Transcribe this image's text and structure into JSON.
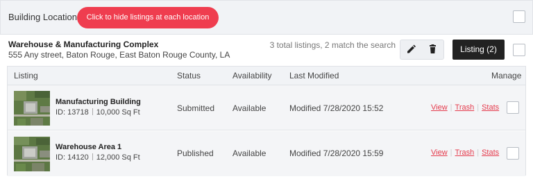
{
  "top_bar": {
    "title": "Building Locations",
    "hide_button": "Click to hide listings at each location"
  },
  "location": {
    "name": "Warehouse & Manufacturing Complex",
    "address": "555 Any street, Baton Rouge, East Baton Rouge County, LA",
    "count_text": "3 total listings, 2 match the search",
    "listing_button": "Listing (2)",
    "edit_icon": "pencil-icon",
    "delete_icon": "trash-icon"
  },
  "table": {
    "headers": {
      "listing": "Listing",
      "status": "Status",
      "availability": "Availability",
      "last_modified": "Last Modified",
      "manage": "Manage"
    },
    "rows": [
      {
        "title": "Manufacturing Building",
        "id_text": "ID: 13718",
        "size": "10,000 Sq Ft",
        "status": "Submitted",
        "availability": "Available",
        "modified": "Modified 7/28/2020 15:52",
        "actions": [
          "View",
          "Trash",
          "Stats"
        ]
      },
      {
        "title": "Warehouse Area 1",
        "id_text": "ID: 14120",
        "size": "12,000 Sq Ft",
        "status": "Published",
        "availability": "Available",
        "modified": "Modified 7/28/2020 15:59",
        "actions": [
          "View",
          "Trash",
          "Stats"
        ]
      }
    ]
  },
  "colors": {
    "accent_red": "#ef3d4f",
    "link_red": "#e53a4c",
    "dark_button": "#222222"
  }
}
